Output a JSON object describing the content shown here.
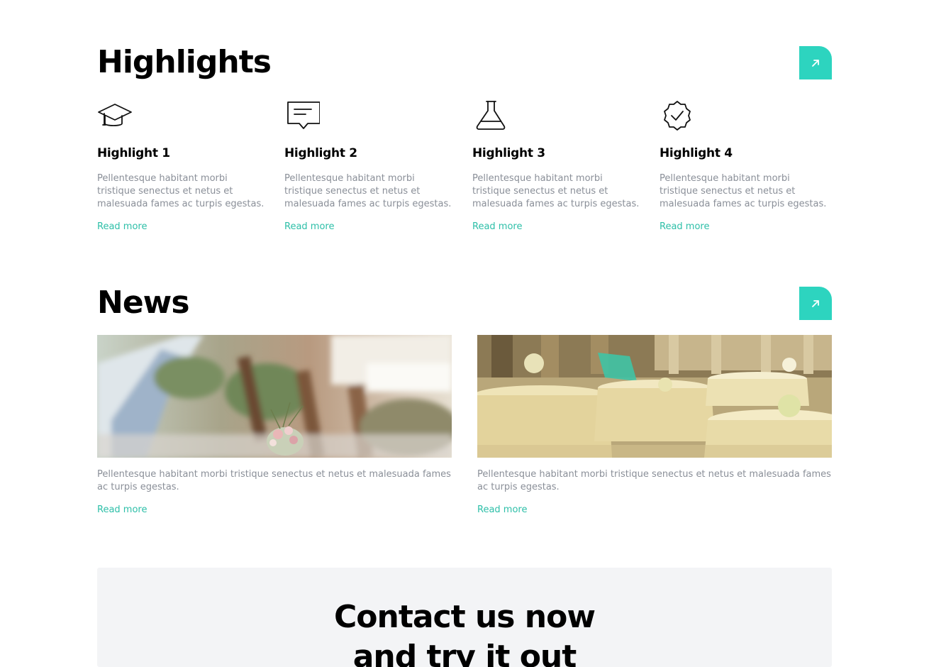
{
  "highlights": {
    "title": "Highlights",
    "items": [
      {
        "icon": "graduation-cap-icon",
        "title": "Highlight 1",
        "text": "Pellentesque habitant morbi tristique senectus et netus et malesuada fames ac turpis egestas.",
        "link": "Read more"
      },
      {
        "icon": "message-icon",
        "title": "Highlight 2",
        "text": "Pellentesque habitant morbi tristique senectus et netus et malesuada fames ac turpis egestas.",
        "link": "Read more"
      },
      {
        "icon": "flask-icon",
        "title": "Highlight 3",
        "text": "Pellentesque habitant morbi tristique senectus et netus et malesuada fames ac turpis egestas.",
        "link": "Read more"
      },
      {
        "icon": "badge-check-icon",
        "title": "Highlight 4",
        "text": "Pellentesque habitant morbi tristique senectus et netus et malesuada fames ac turpis egestas.",
        "link": "Read more"
      }
    ]
  },
  "news": {
    "title": "News",
    "items": [
      {
        "image": "banquet-table-flowers-photo",
        "text": "Pellentesque habitant morbi tristique senectus et netus et malesuada fames ac turpis egestas.",
        "link": "Read more"
      },
      {
        "image": "banquet-hall-tables-photo",
        "text": "Pellentesque habitant morbi tristique senectus et netus et malesuada fames ac turpis egestas.",
        "link": "Read more"
      }
    ]
  },
  "contact": {
    "title_line1": "Contact us now",
    "title_line2": "and try it out"
  },
  "colors": {
    "accent": "#2dd4bf",
    "link": "#2dbfa8",
    "muted_text": "#8a8f98",
    "panel_bg": "#f3f4f6"
  }
}
